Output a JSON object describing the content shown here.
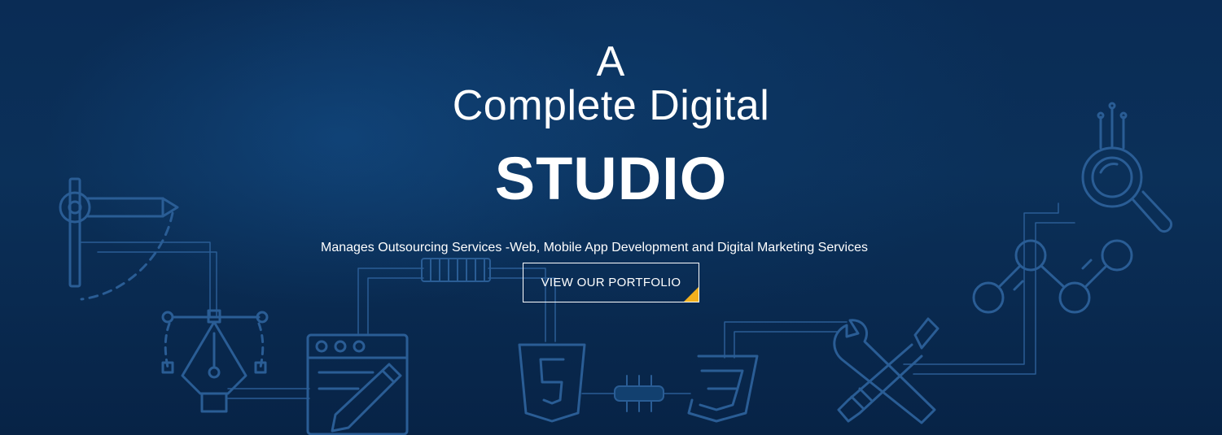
{
  "hero": {
    "headline_line1": "A",
    "headline_line2": "Complete Digital",
    "headline_line3": "STUDIO",
    "tagline": "Manages Outsourcing Services -Web, Mobile App Development and Digital Marketing Services",
    "cta_label": "VIEW OUR PORTFOLIO"
  },
  "colors": {
    "background": "#0b3059",
    "line_art": "#2a5d95",
    "text": "#ffffff",
    "cta_corner": "#f2b01e"
  },
  "icons": [
    "drafting-compass-icon",
    "pen-tool-icon",
    "web-editor-icon",
    "html5-icon",
    "css3-icon",
    "wrench-screwdriver-icon",
    "analytics-network-icon",
    "magnifier-icon"
  ]
}
